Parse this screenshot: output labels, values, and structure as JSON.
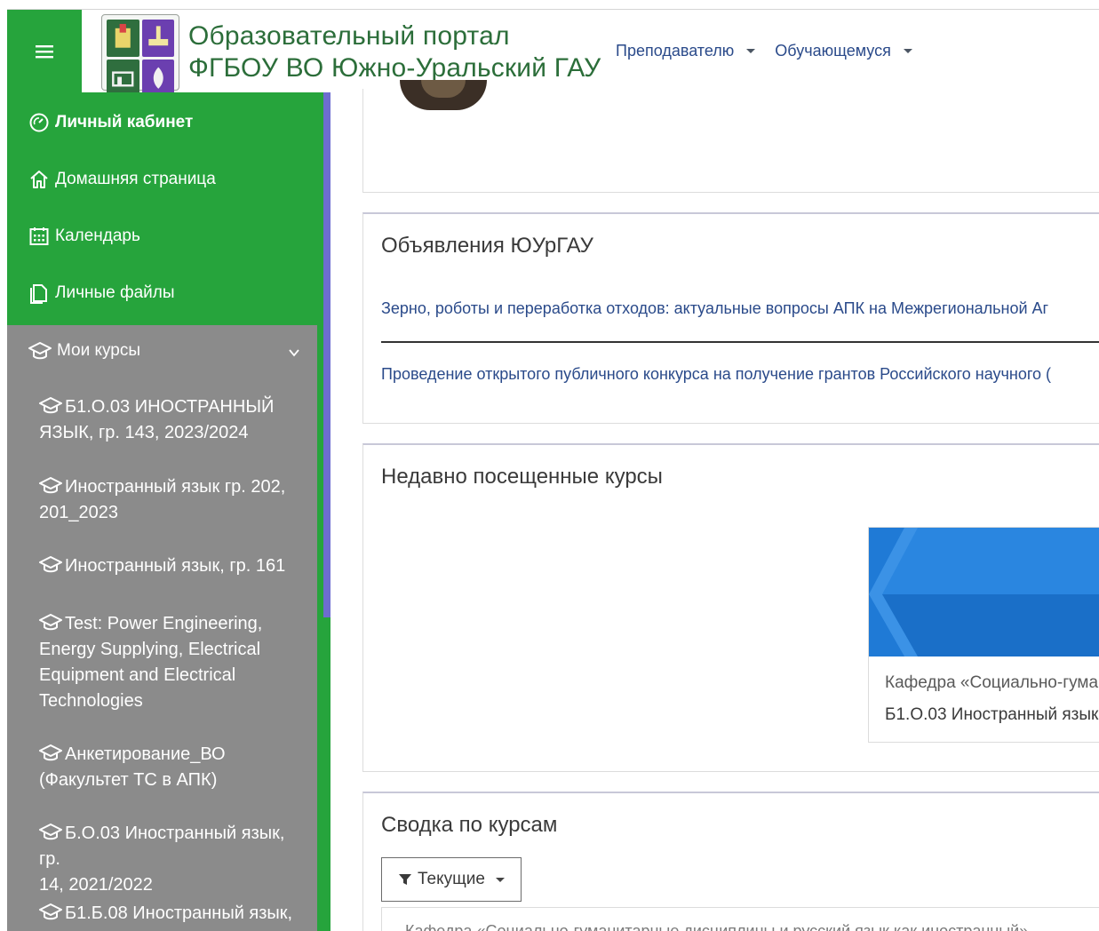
{
  "header": {
    "title_line1": "Образовательный портал",
    "title_line2": "ФГБОУ ВО Южно-Уральский ГАУ",
    "menu": [
      {
        "label": "Преподавателю"
      },
      {
        "label": "Обучающемуся"
      }
    ]
  },
  "sidebar": {
    "items": [
      {
        "label": "Личный кабинет",
        "icon": "dashboard-icon"
      },
      {
        "label": "Домашняя страница",
        "icon": "home-icon"
      },
      {
        "label": "Календарь",
        "icon": "calendar-icon"
      },
      {
        "label": "Личные файлы",
        "icon": "files-icon"
      }
    ],
    "my_courses_label": "Мои курсы",
    "courses": [
      {
        "line1": "Б1.О.03 ИНОСТРАННЫЙ",
        "line2": "ЯЗЫК, гр. 143, 2023/2024"
      },
      {
        "line1": "Иностранный язык гр. 202,",
        "line2": "201_2023"
      },
      {
        "line1": "Иностранный язык, гр. 161",
        "line2": ""
      },
      {
        "line1": "Test: Power Engineering,",
        "line2": "Energy Supplying, Electrical",
        "line3": "Equipment and Electrical",
        "line4": "Technologies"
      },
      {
        "line1": "Анкетирование_ВО",
        "line2": "(Факультет ТС в АПК)"
      },
      {
        "line1": "Б.О.03 Иностранный язык, гр.",
        "line2": "14, 2021/2022"
      },
      {
        "line1": "Б1.Б.08 Иностранный язык,",
        "line2": ""
      }
    ]
  },
  "main": {
    "announcements": {
      "title": "Объявления ЮУрГАУ",
      "items": [
        "Зерно, роботы и переработка отходов: актуальные вопросы АПК на Межрегиональной Аг",
        "Проведение открытого публичного конкурса на получение грантов Российского научного ("
      ]
    },
    "recent": {
      "title": "Недавно посещенные курсы",
      "card": {
        "category": "Кафедра «Социально-гума",
        "name": "Б1.О.03 Иностранный язык"
      }
    },
    "overview": {
      "title": "Сводка по курсам",
      "filter_label": "Текущие",
      "inner_text": "Кафедра «Социально-гуманитарные дисциплины и русский язык как иностранный»"
    }
  },
  "colors": {
    "brand_green": "#26a43c",
    "sidebar_gray": "#8b8b8b",
    "link_blue": "#2a4a8a"
  }
}
